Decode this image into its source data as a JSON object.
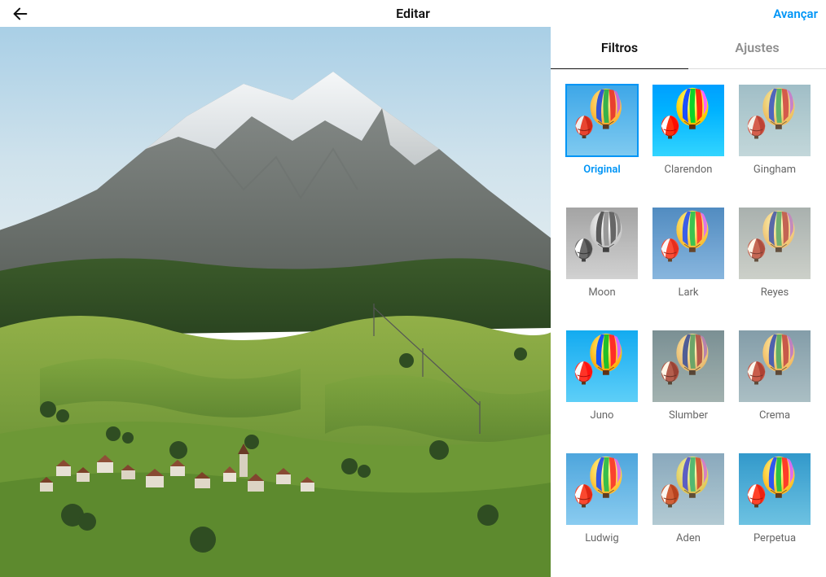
{
  "header": {
    "title": "Editar",
    "advance": "Avançar"
  },
  "tabs": {
    "filters": "Filtros",
    "adjustments": "Ajustes"
  },
  "selectedFilter": "Original",
  "filters": [
    {
      "name": "Original",
      "sky1": "#3ea7e8",
      "sky2": "#7fcaf0",
      "sat": "1",
      "bright": "1",
      "contrast": "1",
      "hue": "0",
      "gray": "0",
      "sepia": "0"
    },
    {
      "name": "Clarendon",
      "sky1": "#1a8de0",
      "sky2": "#55b8ee",
      "sat": "1.3",
      "bright": "1.05",
      "contrast": "1.2",
      "hue": "0",
      "gray": "0",
      "sepia": "0"
    },
    {
      "name": "Gingham",
      "sky1": "#88b5c8",
      "sky2": "#aecfda",
      "sat": "0.85",
      "bright": "1.1",
      "contrast": "0.85",
      "hue": "0",
      "gray": "0",
      "sepia": "0.1"
    },
    {
      "name": "Moon",
      "sky1": "#9a9a9a",
      "sky2": "#c4c4c4",
      "sat": "0",
      "bright": "1.05",
      "contrast": "1.05",
      "hue": "0",
      "gray": "1",
      "sepia": "0"
    },
    {
      "name": "Lark",
      "sky1": "#4a7fb0",
      "sky2": "#7ea8cc",
      "sat": "1.05",
      "bright": "1.1",
      "contrast": "0.95",
      "hue": "0",
      "gray": "0",
      "sepia": "0"
    },
    {
      "name": "Reyes",
      "sky1": "#8aa3b0",
      "sky2": "#b0c2ca",
      "sat": "0.75",
      "bright": "1.1",
      "contrast": "0.85",
      "hue": "0",
      "gray": "0",
      "sepia": "0.22"
    },
    {
      "name": "Juno",
      "sky1": "#3a9fdc",
      "sky2": "#76c2e8",
      "sat": "1.25",
      "bright": "1",
      "contrast": "1.1",
      "hue": "-5",
      "gray": "0",
      "sepia": "0"
    },
    {
      "name": "Slumber",
      "sky1": "#5a8fa8",
      "sky2": "#85b0c2",
      "sat": "0.7",
      "bright": "1",
      "contrast": "0.95",
      "hue": "0",
      "gray": "0",
      "sepia": "0.25"
    },
    {
      "name": "Crema",
      "sky1": "#6a97b2",
      "sky2": "#94b9cc",
      "sat": "0.8",
      "bright": "1.05",
      "contrast": "0.9",
      "hue": "0",
      "gray": "0",
      "sepia": "0.15"
    },
    {
      "name": "Ludwig",
      "sky1": "#4a9bcf",
      "sky2": "#80bde0",
      "sat": "1.05",
      "bright": "1.05",
      "contrast": "1.05",
      "hue": "0",
      "gray": "0",
      "sepia": "0.05"
    },
    {
      "name": "Aden",
      "sky1": "#6a9fb5",
      "sky2": "#96bfca",
      "sat": "0.85",
      "bright": "1.1",
      "contrast": "0.9",
      "hue": "10",
      "gray": "0",
      "sepia": "0.1"
    },
    {
      "name": "Perpetua",
      "sky1": "#3a8fb8",
      "sky2": "#6fb5cf",
      "sat": "1.1",
      "bright": "1.05",
      "contrast": "1.05",
      "hue": "0",
      "gray": "0",
      "sepia": "0"
    }
  ]
}
